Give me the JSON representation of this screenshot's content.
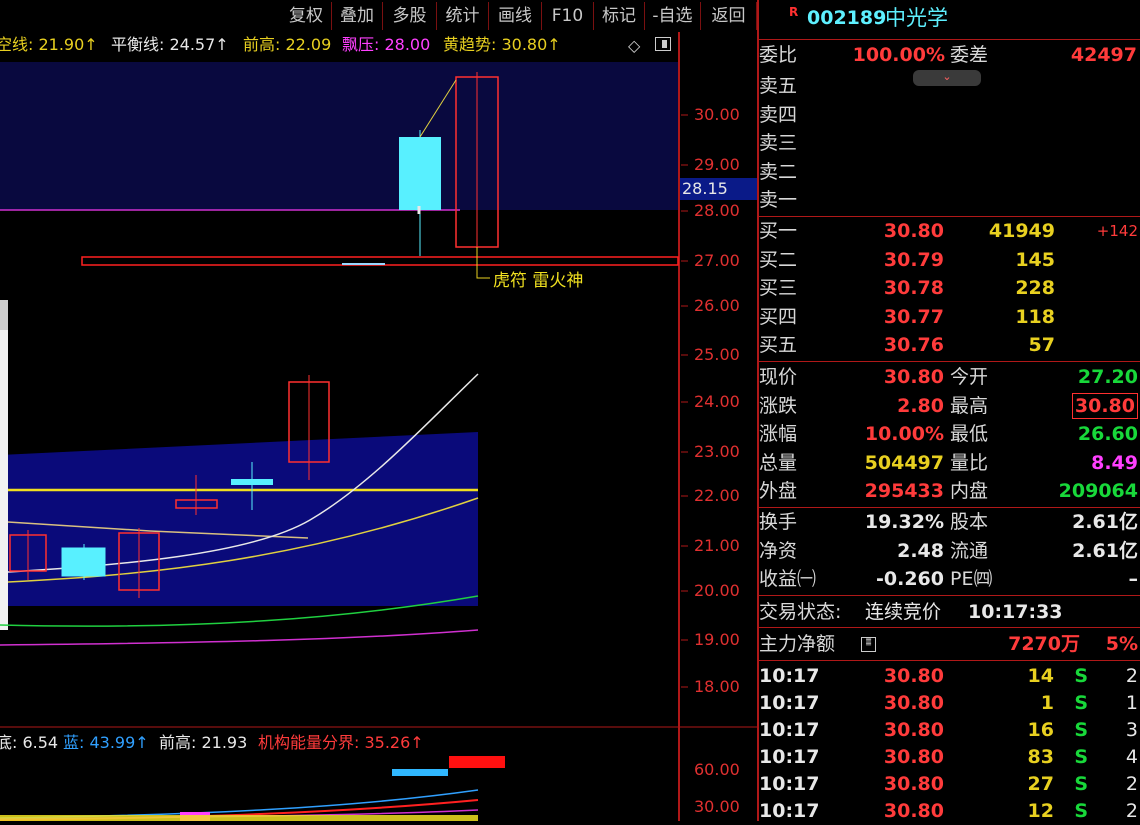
{
  "toolbar": {
    "buttons": [
      "复权",
      "叠加",
      "多股",
      "统计",
      "画线",
      "F10",
      "标记",
      "-自选",
      "返回"
    ]
  },
  "indicator_top": [
    {
      "text": "空线: 21.90↑",
      "color": "#e8d020"
    },
    {
      "text": "平衡线: 24.57↑",
      "color": "#e8e8e8"
    },
    {
      "text": "前高: 22.09",
      "color": "#e8d020"
    },
    {
      "text": "飘压: 28.00",
      "color": "#ff40ff"
    },
    {
      "text": "黄趋势: 30.80↑",
      "color": "#e8d020"
    }
  ],
  "indicator_bottom": [
    {
      "text": "底: 6.54",
      "color": "#e8e8e8"
    },
    {
      "text": "蓝: 43.99↑",
      "color": "#30a0ff"
    },
    {
      "text": "前高: 21.93",
      "color": "#e8e8e8"
    },
    {
      "text": "机构能量分界: 35.26↑",
      "color": "#ff3b3b"
    }
  ],
  "chart": {
    "y_ticks": [
      "30.00",
      "29.00",
      "28.00",
      "27.00",
      "26.00",
      "25.00",
      "24.00",
      "23.00",
      "22.00",
      "21.00",
      "20.00",
      "19.00",
      "18.00"
    ],
    "current_price_tag": "28.15",
    "annotation": "虎符 雷火神",
    "sub_ticks": [
      "60.00",
      "30.00"
    ]
  },
  "stock": {
    "badge": "R",
    "code": "002189",
    "name": "中光学"
  },
  "weibi": {
    "label": "委比",
    "value": "100.00%",
    "diff_label": "委差",
    "diff_value": "42497"
  },
  "sell": [
    {
      "label": "卖五"
    },
    {
      "label": "卖四"
    },
    {
      "label": "卖三"
    },
    {
      "label": "卖二"
    },
    {
      "label": "卖一"
    }
  ],
  "buy": [
    {
      "label": "买一",
      "price": "30.80",
      "vol": "41949",
      "chg": "+142"
    },
    {
      "label": "买二",
      "price": "30.79",
      "vol": "145",
      "chg": ""
    },
    {
      "label": "买三",
      "price": "30.78",
      "vol": "228",
      "chg": ""
    },
    {
      "label": "买四",
      "price": "30.77",
      "vol": "118",
      "chg": ""
    },
    {
      "label": "买五",
      "price": "30.76",
      "vol": "57",
      "chg": ""
    }
  ],
  "quote": [
    {
      "l1": "现价",
      "v1": "30.80",
      "l2": "今开",
      "v2": "27.20",
      "c1": "red",
      "c2": "green"
    },
    {
      "l1": "涨跌",
      "v1": "2.80",
      "l2": "最高",
      "v2": "30.80",
      "c1": "red",
      "c2": "red"
    },
    {
      "l1": "涨幅",
      "v1": "10.00%",
      "l2": "最低",
      "v2": "26.60",
      "c1": "red",
      "c2": "green"
    },
    {
      "l1": "总量",
      "v1": "504497",
      "l2": "量比",
      "v2": "8.49",
      "c1": "yel",
      "c2": "mag"
    },
    {
      "l1": "外盘",
      "v1": "295433",
      "l2": "内盘",
      "v2": "209064",
      "c1": "red",
      "c2": "green"
    }
  ],
  "fund": [
    {
      "l1": "换手",
      "v1": "19.32%",
      "l2": "股本",
      "v2": "2.61亿"
    },
    {
      "l1": "净资",
      "v1": "2.48",
      "l2": "流通",
      "v2": "2.61亿"
    },
    {
      "l1": "收益㈠",
      "v1": "-0.260",
      "l2": "PE㈣",
      "v2": "–"
    }
  ],
  "status": {
    "label": "交易状态:",
    "value": "连续竞价",
    "time": "10:17:33"
  },
  "mainforce": {
    "label": "主力净额",
    "value": "7270万",
    "pct": "5%"
  },
  "trades": [
    {
      "time": "10:17",
      "price": "30.80",
      "vol": "14",
      "side": "S",
      "n": "2"
    },
    {
      "time": "10:17",
      "price": "30.80",
      "vol": "1",
      "side": "S",
      "n": "1"
    },
    {
      "time": "10:17",
      "price": "30.80",
      "vol": "16",
      "side": "S",
      "n": "3"
    },
    {
      "time": "10:17",
      "price": "30.80",
      "vol": "83",
      "side": "S",
      "n": "4"
    },
    {
      "time": "10:17",
      "price": "30.80",
      "vol": "27",
      "side": "S",
      "n": "2"
    },
    {
      "time": "10:17",
      "price": "30.80",
      "vol": "12",
      "side": "S",
      "n": "2"
    }
  ]
}
